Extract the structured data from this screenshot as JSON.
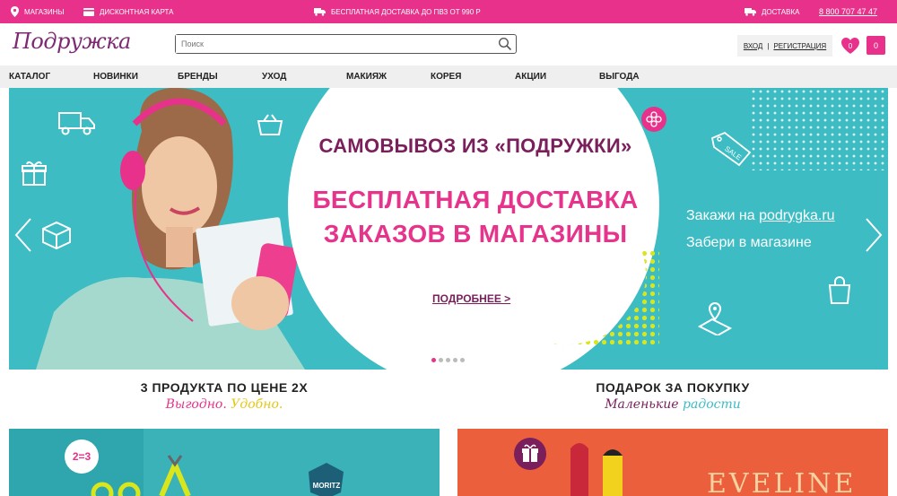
{
  "topbar": {
    "stores": "МАГАЗИНЫ",
    "card": "ДИСКОНТНАЯ КАРТА",
    "free_delivery": "БЕСПЛАТНАЯ ДОСТАВКА ДО ПВЗ ОТ 990 Р",
    "delivery": "ДОСТАВКА",
    "phone": "8 800 707 47 47"
  },
  "header": {
    "logo": "Подружка",
    "search_placeholder": "Поиск",
    "login": "ВХОД",
    "separator": "|",
    "register": "РЕГИСТРАЦИЯ",
    "favorites_count": "0",
    "cart_count": "0"
  },
  "nav": [
    "КАТАЛОГ",
    "НОВИНКИ",
    "БРЕНДЫ",
    "УХОД",
    "МАКИЯЖ",
    "КОРЕЯ",
    "АКЦИИ",
    "ВЫГОДА"
  ],
  "hero": {
    "top_line": "САМОВЫВОЗ ИЗ «ПОДРУЖКИ»",
    "main_line1": "БЕСПЛАТНАЯ ДОСТАВКА",
    "main_line2": "ЗАКАЗОВ В МАГАЗИНЫ",
    "more": "ПОДРОБНЕЕ >",
    "right_prefix": "Закажи на ",
    "right_link": "podrygka.ru",
    "right_line2": "Забери в магазине",
    "sale_tag": "SALE",
    "slides": 5,
    "active_slide": 1
  },
  "promos": [
    {
      "title": "3 ПРОДУКТА ПО ЦЕНЕ 2Х",
      "sub1": "Выгодно. ",
      "sub2": "Удобно.",
      "sub1_color": "#e6338b",
      "sub2_color": "#e2c81a"
    },
    {
      "title": "ПОДАРОК ЗА ПОКУПКУ",
      "sub1": "Маленькие ",
      "sub2": "радости",
      "sub1_color": "#7a1f5c",
      "sub2_color": "#3dbcc4"
    }
  ],
  "banners": {
    "left_badge": "2=3",
    "left_brand": "MORITZ",
    "right_brand": "EVELINE"
  },
  "colors": {
    "brand_pink": "#e8318a",
    "brand_purple": "#7a1f5c",
    "hero_teal": "#3dbcc4"
  }
}
